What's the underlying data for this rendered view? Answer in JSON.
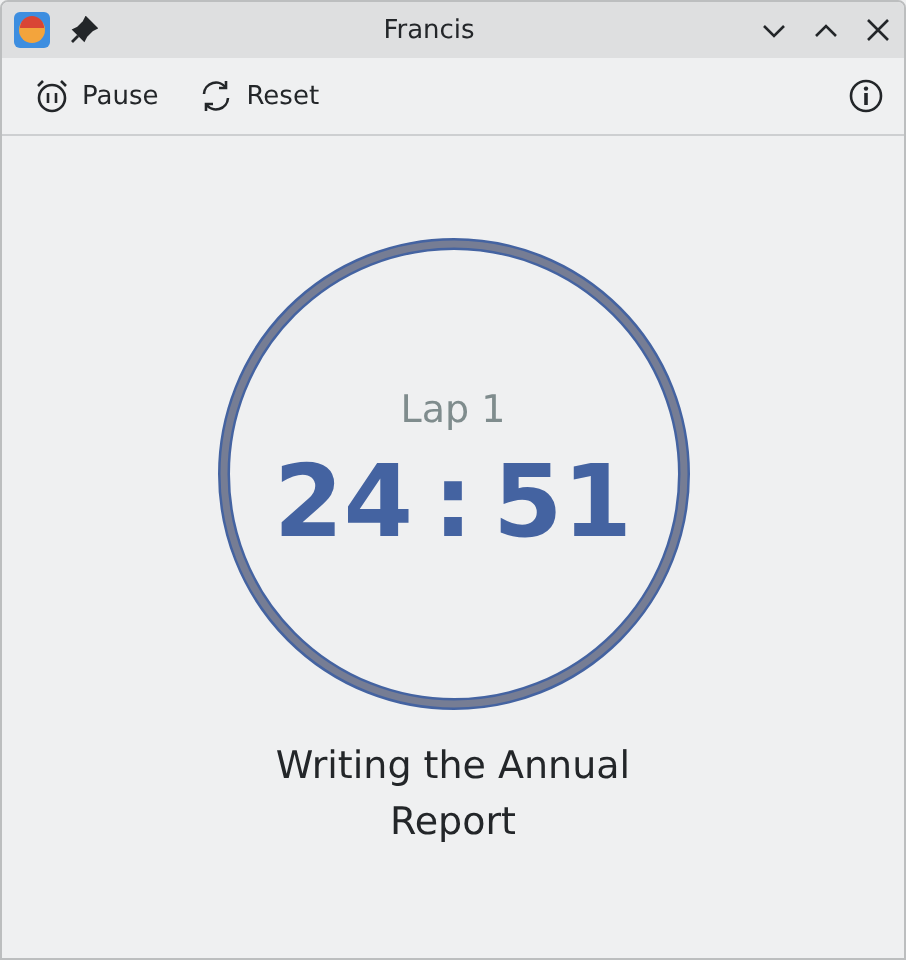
{
  "window": {
    "title": "Francis"
  },
  "toolbar": {
    "buttons": [
      {
        "kind": "pause",
        "label": "Pause"
      },
      {
        "kind": "reset",
        "label": "Reset"
      }
    ]
  },
  "timer": {
    "lap": "Lap 1",
    "minutes": "24",
    "separator": ":",
    "seconds": "51",
    "task": "Writing the Annual Report"
  }
}
